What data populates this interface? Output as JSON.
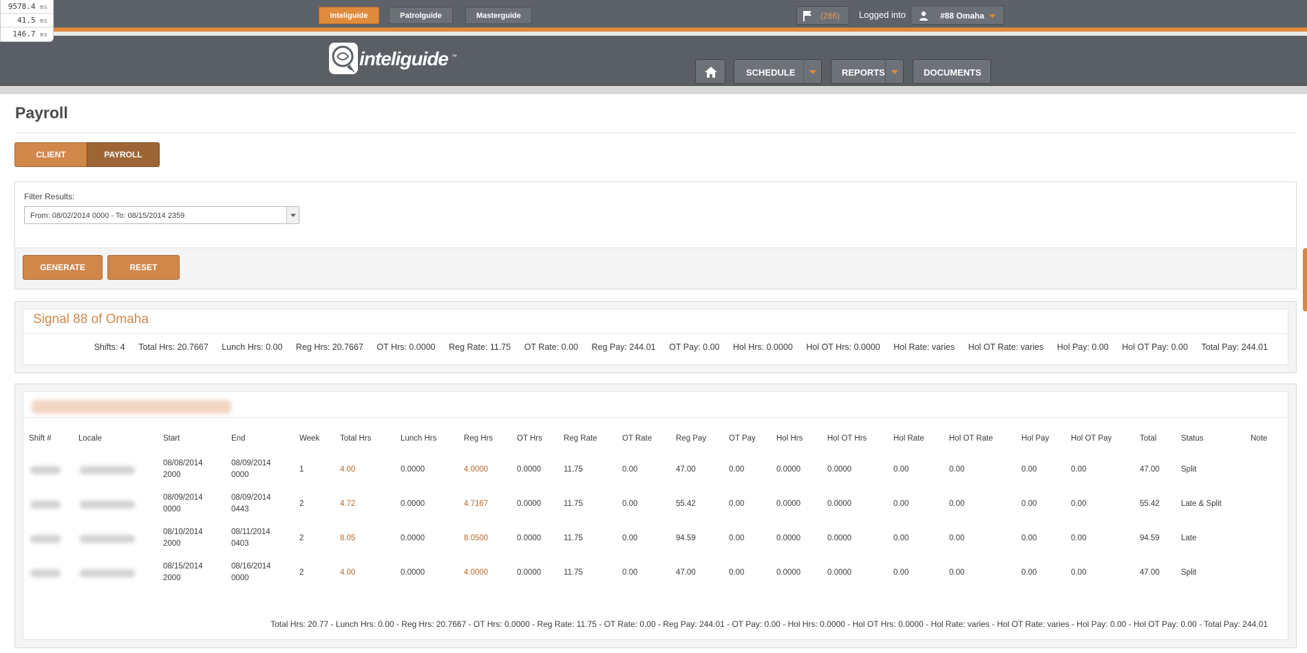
{
  "perf": [
    {
      "value": "9578.4",
      "unit": "ms"
    },
    {
      "value": "41.5",
      "unit": "ms"
    },
    {
      "value": "146.7",
      "unit": "ms"
    }
  ],
  "topbar": {
    "apps": [
      "Inteliguide",
      "Patrolguide",
      "Masterguide"
    ],
    "active_app": "Inteliguide",
    "flag_count": "(286)",
    "logged_label": "Logged into",
    "user": "#88 Omaha"
  },
  "brand": {
    "name": "inteliguide",
    "tm": "™"
  },
  "nav": {
    "home": "home",
    "schedule": "SCHEDULE",
    "reports": "REPORTS",
    "documents": "DOCUMENTS"
  },
  "page": {
    "title": "Payroll",
    "tabs": [
      "CLIENT",
      "PAYROLL"
    ],
    "active_tab": "PAYROLL"
  },
  "filter": {
    "label": "Filter Results:",
    "selected": "From: 08/02/2014 0000 - To: 08/15/2014 2359",
    "generate": "GENERATE",
    "reset": "RESET"
  },
  "summary": {
    "title": "Signal 88 of Omaha",
    "items": [
      "Shifts: 4",
      "Total Hrs: 20.7667",
      "Lunch Hrs: 0.00",
      "Reg Hrs: 20.7667",
      "OT Hrs: 0.0000",
      "Reg Rate: 11.75",
      "OT Rate: 0.00",
      "Reg Pay: 244.01",
      "OT Pay: 0.00",
      "Hol Hrs: 0.0000",
      "Hol OT Hrs: 0.0000",
      "Hol Rate: varies",
      "Hol OT Rate: varies",
      "Hol Pay: 0.00",
      "Hol OT Pay: 0.00",
      "Total Pay: 244.01"
    ]
  },
  "table": {
    "headers": [
      "Shift #",
      "Locale",
      "Start",
      "End",
      "Week",
      "Total Hrs",
      "Lunch Hrs",
      "Reg Hrs",
      "OT Hrs",
      "Reg Rate",
      "OT Rate",
      "Reg Pay",
      "OT Pay",
      "Hol Hrs",
      "Hol OT Hrs",
      "Hol Rate",
      "Hol OT Rate",
      "Hol Pay",
      "Hol OT Pay",
      "Total",
      "Status",
      "Note"
    ],
    "rows": [
      {
        "start": [
          "08/08/2014",
          "2000"
        ],
        "end": [
          "08/09/2014",
          "0000"
        ],
        "week": "1",
        "total_hrs": "4.00",
        "lunch_hrs": "0.0000",
        "reg_hrs": "4.0000",
        "ot_hrs": "0.0000",
        "reg_rate": "11.75",
        "ot_rate": "0.00",
        "reg_pay": "47.00",
        "ot_pay": "0.00",
        "hol_hrs": "0.0000",
        "hol_ot_hrs": "0.0000",
        "hol_rate": "0.00",
        "hol_ot_rate": "0.00",
        "hol_pay": "0.00",
        "hol_ot_pay": "0.00",
        "total": "47.00",
        "status": "Split",
        "note": ""
      },
      {
        "start": [
          "08/09/2014",
          "0000"
        ],
        "end": [
          "08/09/2014",
          "0443"
        ],
        "week": "2",
        "total_hrs": "4.72",
        "lunch_hrs": "0.0000",
        "reg_hrs": "4.7167",
        "ot_hrs": "0.0000",
        "reg_rate": "11.75",
        "ot_rate": "0.00",
        "reg_pay": "55.42",
        "ot_pay": "0.00",
        "hol_hrs": "0.0000",
        "hol_ot_hrs": "0.0000",
        "hol_rate": "0.00",
        "hol_ot_rate": "0.00",
        "hol_pay": "0.00",
        "hol_ot_pay": "0.00",
        "total": "55.42",
        "status": "Late & Split",
        "note": ""
      },
      {
        "start": [
          "08/10/2014",
          "2000"
        ],
        "end": [
          "08/11/2014",
          "0403"
        ],
        "week": "2",
        "total_hrs": "8.05",
        "lunch_hrs": "0.0000",
        "reg_hrs": "8.0500",
        "ot_hrs": "0.0000",
        "reg_rate": "11.75",
        "ot_rate": "0.00",
        "reg_pay": "94.59",
        "ot_pay": "0.00",
        "hol_hrs": "0.0000",
        "hol_ot_hrs": "0.0000",
        "hol_rate": "0.00",
        "hol_ot_rate": "0.00",
        "hol_pay": "0.00",
        "hol_ot_pay": "0.00",
        "total": "94.59",
        "status": "Late",
        "note": ""
      },
      {
        "start": [
          "08/15/2014",
          "2000"
        ],
        "end": [
          "08/16/2014",
          "0000"
        ],
        "week": "2",
        "total_hrs": "4.00",
        "lunch_hrs": "0.0000",
        "reg_hrs": "4.0000",
        "ot_hrs": "0.0000",
        "reg_rate": "11.75",
        "ot_rate": "0.00",
        "reg_pay": "47.00",
        "ot_pay": "0.00",
        "hol_hrs": "0.0000",
        "hol_ot_hrs": "0.0000",
        "hol_rate": "0.00",
        "hol_ot_rate": "0.00",
        "hol_pay": "0.00",
        "hol_ot_pay": "0.00",
        "total": "47.00",
        "status": "Split",
        "note": ""
      }
    ],
    "totals": "Total Hrs: 20.77 - Lunch Hrs: 0.00 - Reg Hrs: 20.7667 - OT Hrs: 0.0000 - Reg Rate: 11.75 - OT Rate: 0.00 - Reg Pay: 244.01 - OT Pay: 0.00 - Hol Hrs: 0.0000 - Hol OT Hrs: 0.0000 - Hol Rate: varies - Hol OT Rate: varies - Hol Pay: 0.00 - Hol OT Pay: 0.00 - Total Pay: 244.01"
  },
  "colors": {
    "accent": "#e08a3c",
    "button": "#d1874a",
    "button_active": "#9d6535",
    "dark_bar": "#5d6268"
  },
  "icons": [
    "flag-icon",
    "user-icon",
    "home-icon",
    "chevron-down-icon",
    "logo-mark-icon"
  ]
}
